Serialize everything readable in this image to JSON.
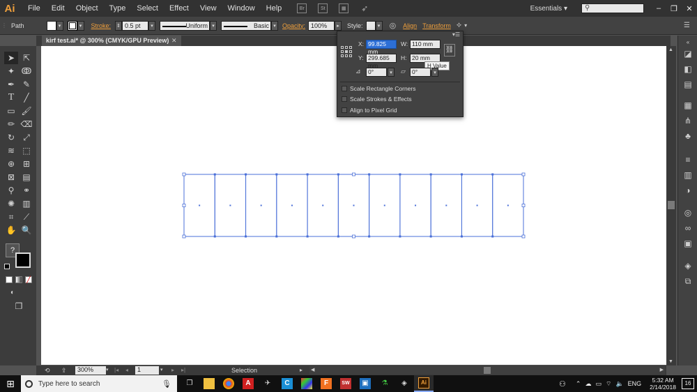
{
  "app": {
    "logo": "Ai",
    "menus": [
      "File",
      "Edit",
      "Object",
      "Type",
      "Select",
      "Effect",
      "View",
      "Window",
      "Help"
    ],
    "bridge_icon": "Br",
    "stock_icon": "St",
    "workspace": "Essentials",
    "window_controls": [
      "–",
      "❐",
      "✕"
    ]
  },
  "control_bar": {
    "selection_label": "Path",
    "stroke_label": "Stroke:",
    "stroke_weight": "0.5 pt",
    "profile": "Uniform",
    "brush": "Basic",
    "opacity_label": "Opacity:",
    "opacity": "100%",
    "style_label": "Style:",
    "align_link": "Align",
    "transform_link": "Transform"
  },
  "document": {
    "tab_title": "kirf test.ai* @ 300% (CMYK/GPU Preview)",
    "close_label": "✕"
  },
  "transform_panel": {
    "x_label": "X:",
    "x_value": "99.825 mm",
    "y_label": "Y:",
    "y_value": "299.685 mm",
    "w_label": "W:",
    "w_value": "110 mm",
    "h_label": "H:",
    "h_value": "20 mm",
    "rotate_value": "0°",
    "shear_value": "0°",
    "tooltip": "H Value",
    "options": [
      "Scale Rectangle Corners",
      "Scale Strokes & Effects",
      "Align to Pixel Grid"
    ]
  },
  "status_bar": {
    "zoom": "300%",
    "artboard": "1",
    "tool_status": "Selection"
  },
  "taskbar": {
    "search_placeholder": "Type here to search",
    "language": "ENG",
    "time": "5:32 AM",
    "date": "2/14/2018",
    "notification_count": "16"
  },
  "artwork": {
    "column_count": 11,
    "stroke_color": "#4a6fd8"
  },
  "colors": {
    "accent_orange": "#f0a03c",
    "selection_blue": "#2d6fd6"
  }
}
